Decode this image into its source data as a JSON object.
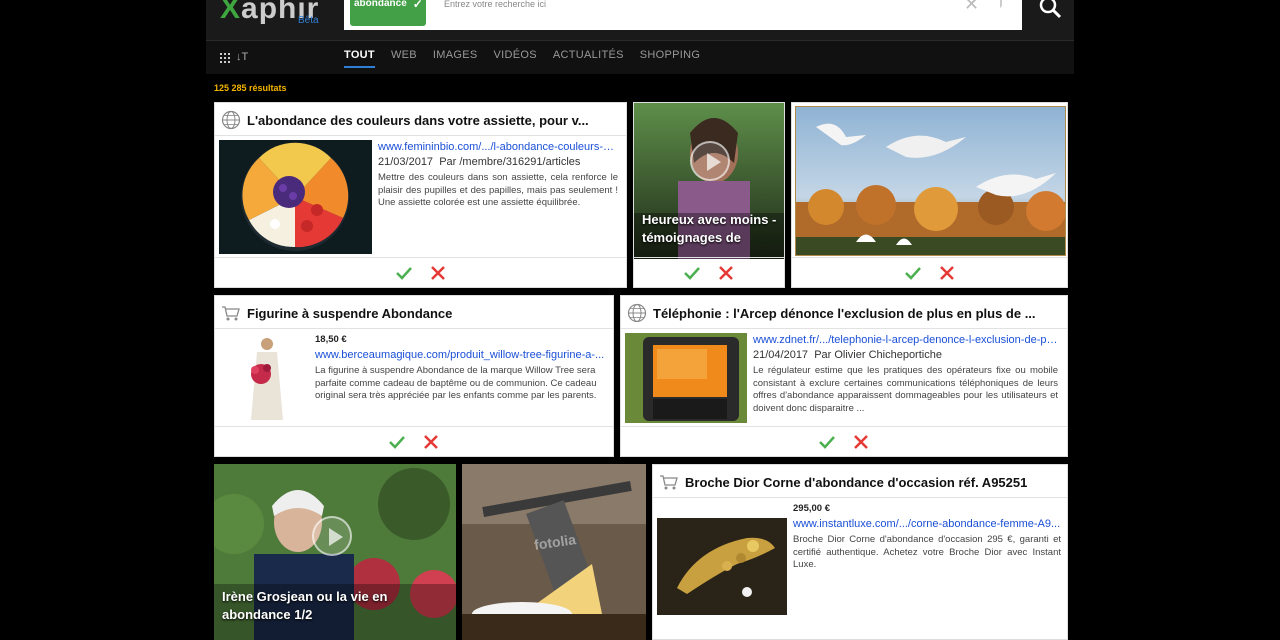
{
  "header": {
    "logo_text": "Xaphir",
    "logo_badge": "Bêta",
    "chip_label": "abondance",
    "search_placeholder": "Entrez votre recherche ici"
  },
  "nav": {
    "tabs": [
      "TOUT",
      "WEB",
      "IMAGES",
      "VIDÉOS",
      "ACTUALITÉS",
      "SHOPPING"
    ],
    "sort_icon_text": "↓T"
  },
  "results_count": "125 285 résultats",
  "cards": {
    "c1": {
      "title": "L'abondance des couleurs dans votre assiette, pour v...",
      "url": "www.femininbio.com/.../l-abondance-couleurs-d...",
      "date": "21/03/2017",
      "author": "Par /membre/316291/articles",
      "snippet": "Mettre des couleurs dans son assiette, cela renforce le plaisir des pupilles et des papilles, mais pas seulement ! Une assiette colorée est une assiette équilibrée."
    },
    "c2": {
      "title": "Heureux avec moins - témoignages de"
    },
    "c4": {
      "title": "Figurine à suspendre Abondance",
      "price": "18,50 €",
      "url": "www.berceaumagique.com/produit_willow-tree-figurine-a-...",
      "snippet": "La figurine à suspendre Abondance de la marque Willow Tree sera parfaite comme cadeau de baptême ou de communion. Ce cadeau original sera très appréciée par les enfants comme par les parents."
    },
    "c5": {
      "title": "Téléphonie : l'Arcep dénonce l'exclusion de plus en plus de ...",
      "url": "www.zdnet.fr/.../telephonie-l-arcep-denonce-l-exclusion-de-pl...",
      "date": "21/04/2017",
      "author": "Par Olivier Chicheportiche",
      "snippet": "Le régulateur estime que les pratiques des opérateurs fixe ou mobile consistant à exclure certaines communications téléphoniques de leurs offres d'abondance apparaissent dommageables pour les utilisateurs et doivent donc disparaitre ..."
    },
    "c6": {
      "title": "Irène Grosjean ou la vie en abondance 1/2"
    },
    "c7": {
      "watermark": "fotolia"
    },
    "c8": {
      "title": "Broche Dior Corne d'abondance d'occasion réf. A95251",
      "price": "295,00 €",
      "url": "www.instantluxe.com/.../corne-abondance-femme-A9...",
      "snippet": "Broche Dior Corne d'abondance d'occasion 295 €, garanti et certifié authentique. Achetez votre Broche Dior avec Instant Luxe."
    }
  },
  "colors": {
    "accent_green": "#43a047",
    "link_blue": "#1a4fd6",
    "count_yellow": "#f5b400",
    "approve": "#4caf50",
    "reject": "#e53935"
  }
}
